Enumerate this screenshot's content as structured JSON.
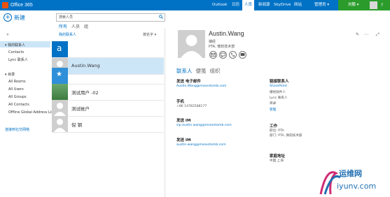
{
  "app": {
    "title": "Office 365"
  },
  "nav": {
    "items": [
      "Outlook",
      "日历",
      "人员",
      "新闻源",
      "SkyDrive",
      "网站"
    ],
    "active": "人员",
    "admin": "管理员 ▾",
    "user": "刘鹏 ▾",
    "help": "?"
  },
  "new_button": {
    "label": "新建"
  },
  "collapse": "«",
  "left": {
    "section1": "▾ 我的联系人",
    "items1": [
      "Contacts",
      "Lync 联系人"
    ],
    "section2": "▾ 目录",
    "items2": [
      "All Rooms",
      "All Users",
      "All Groups",
      "All Contacts",
      "Offline Global Address List"
    ],
    "link": "连接到社交网络"
  },
  "search": {
    "placeholder": "搜索人员"
  },
  "filters": [
    "所有",
    "人员",
    "组"
  ],
  "list": {
    "header": "我的联系人",
    "sort": "按名字 ▾",
    "rows": [
      {
        "name": "",
        "tile": "letter",
        "letter": "a"
      },
      {
        "name": "Austin.Wang",
        "tile": "person"
      },
      {
        "name": "",
        "tile": "star"
      },
      {
        "name": "测试用户 -02",
        "tile": "image"
      },
      {
        "name": "测试帐户",
        "tile": "person"
      },
      {
        "name": "倪 钢",
        "tile": "person"
      }
    ]
  },
  "contact": {
    "name": "Austin.Wang",
    "title": "播经",
    "dept": "PTA, 微软技术部",
    "tabs": [
      "联系人",
      "便笺",
      "组织"
    ],
    "left_fields": [
      {
        "label": "发送 电子邮件",
        "value": "Austin.Wang@msexstomb.com",
        "link": true
      },
      {
        "label": "手机",
        "value": "+86 14782588177",
        "link": false
      },
      {
        "label": "发送 IM",
        "value": "sip:austin.wang@msexstomb.com",
        "link": true
      },
      {
        "label": "发送 IM",
        "value": "austin.wang@msexstomb.com",
        "link": true
      }
    ],
    "right_sections": [
      {
        "label": "链接联系人",
        "lines": [
          "SharePoint",
          "播经收件人",
          "Lync 联系人",
          "目录",
          "管理"
        ]
      },
      {
        "label": "工作",
        "lines": [
          "职位:  PTA",
          "部门:  PTA, 微软技术部"
        ]
      },
      {
        "label": "家庭地址",
        "lines": [
          "中国 上海"
        ]
      }
    ]
  },
  "watermark": {
    "title": "运维网",
    "sub": "iyunv.com"
  },
  "colors": {
    "brand": "#0072c6",
    "user_bg": "#2b9c2b",
    "selected": "#cde6f7"
  }
}
